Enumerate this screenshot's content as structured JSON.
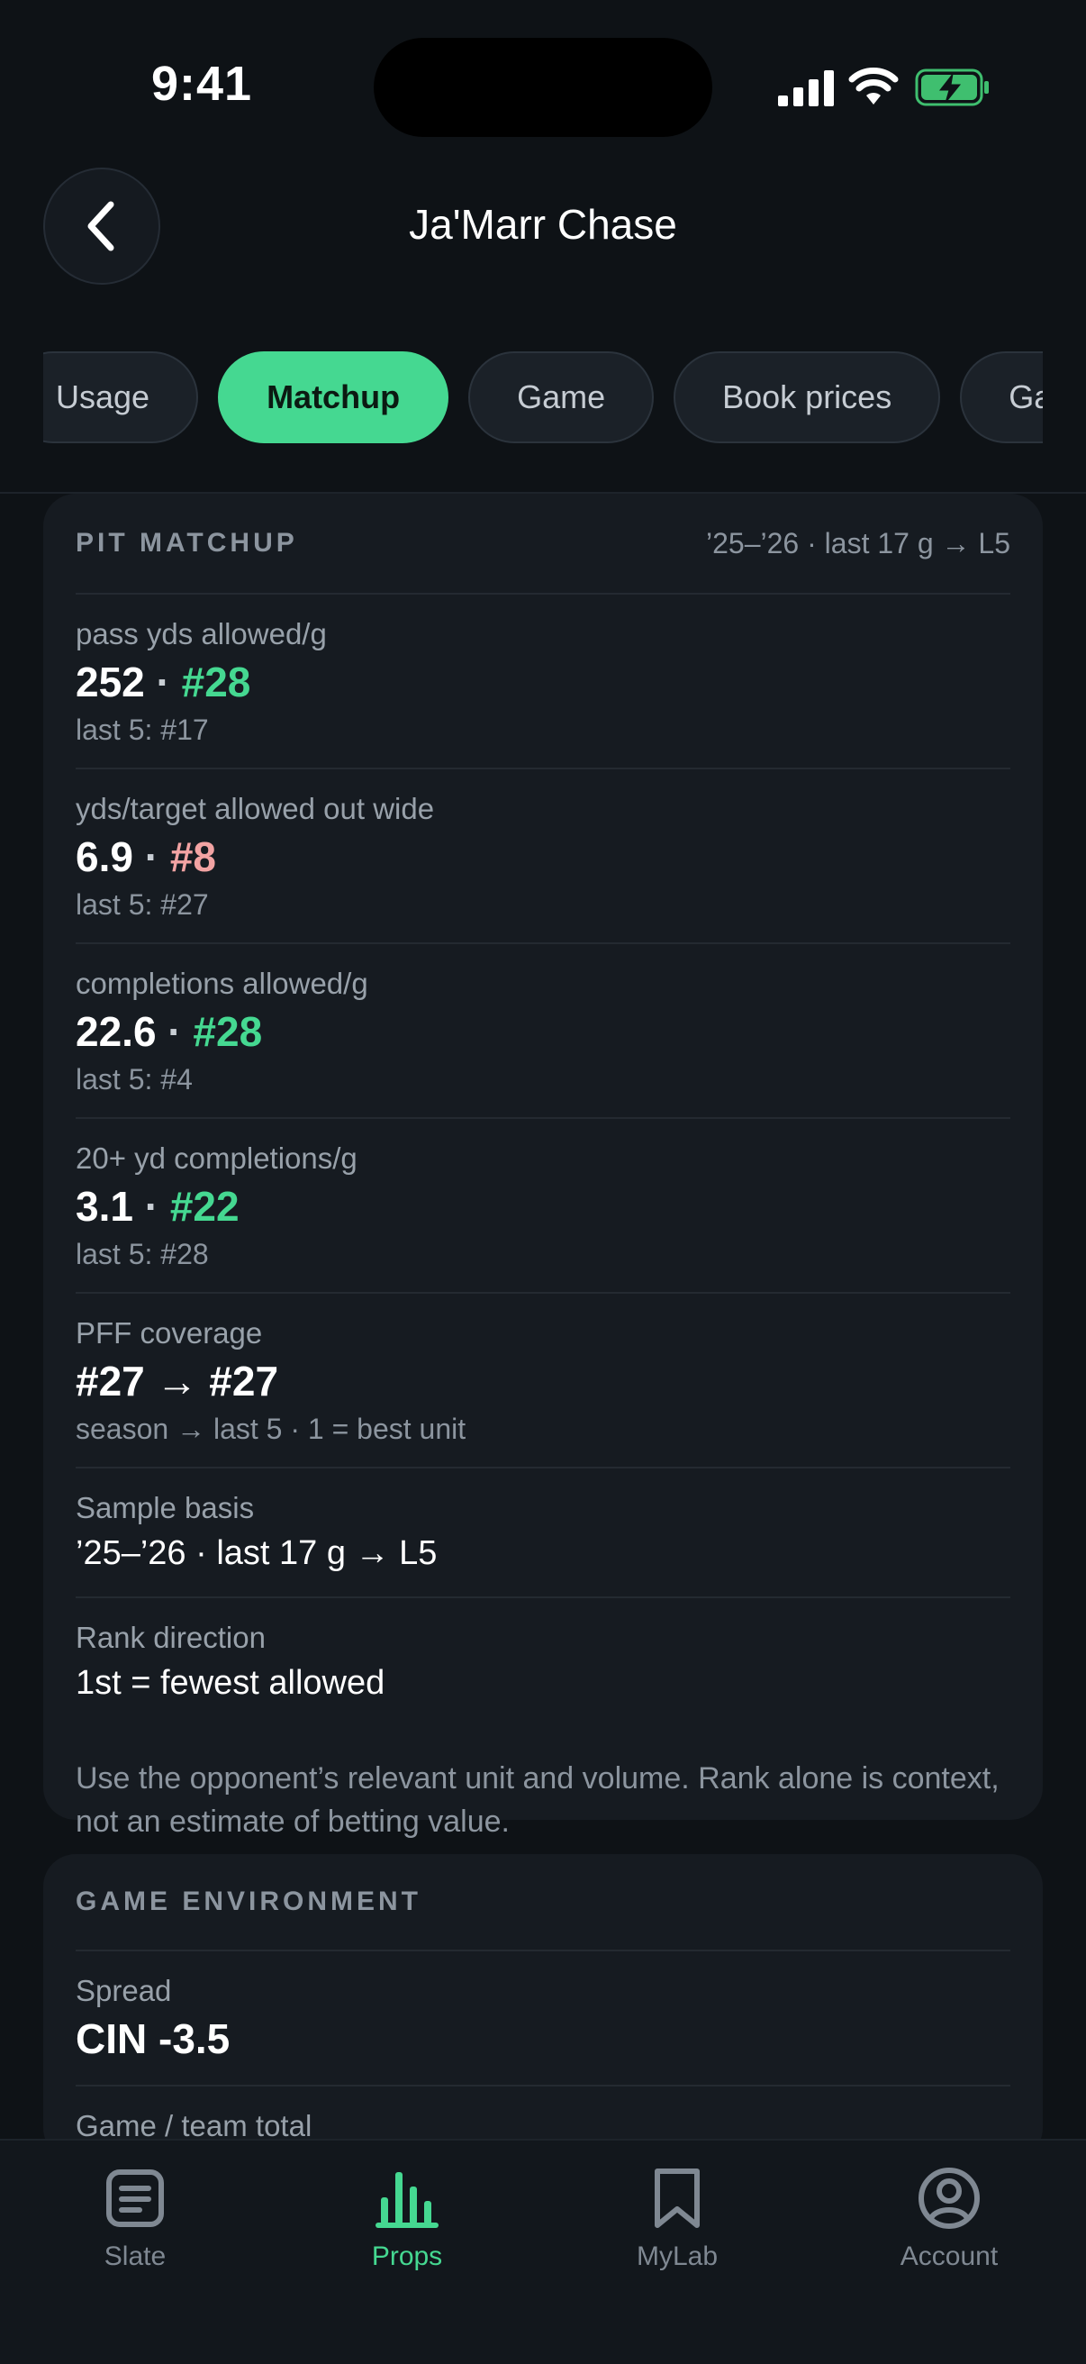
{
  "status": {
    "time": "9:41"
  },
  "header": {
    "title": "Ja'Marr Chase"
  },
  "tabs": [
    {
      "label": "Usage",
      "active": false
    },
    {
      "label": "Matchup",
      "active": true
    },
    {
      "label": "Game",
      "active": false
    },
    {
      "label": "Book prices",
      "active": false
    },
    {
      "label": "Game",
      "active": false
    }
  ],
  "matchup": {
    "title": "PIT MATCHUP",
    "meta": "’25–’26 · last 17 g → L5",
    "rows": [
      {
        "label": "pass yds allowed/g",
        "value": "252",
        "rank": "#28",
        "sub": "last 5: #17"
      },
      {
        "label": "yds/target allowed out wide",
        "value": "6.9",
        "rank": "#8",
        "sub": "last 5: #27"
      },
      {
        "label": "completions allowed/g",
        "value": "22.6",
        "rank": "#28",
        "sub": "last 5: #4"
      },
      {
        "label": "20+ yd completions/g",
        "value": "3.1",
        "rank": "#22",
        "sub": "last 5: #28"
      },
      {
        "label": "PFF coverage",
        "value": "#27 → #27",
        "sub": "season → last 5 · 1 = best unit"
      },
      {
        "label": "Sample basis",
        "value": "’25–’26 · last 17 g → L5"
      },
      {
        "label": "Rank direction",
        "value": "1st = fewest allowed"
      }
    ],
    "note": "Use the opponent’s relevant unit and volume. Rank alone is context, not an estimate of betting value."
  },
  "environment": {
    "title": "GAME ENVIRONMENT",
    "rows": [
      {
        "label": "Spread",
        "value": "CIN -3.5"
      },
      {
        "label": "Game / team total"
      }
    ]
  },
  "nav": [
    {
      "label": "Slate",
      "icon": "document-icon",
      "active": false
    },
    {
      "label": "Props",
      "icon": "bar-chart-icon",
      "active": true
    },
    {
      "label": "MyLab",
      "icon": "bookmark-icon",
      "active": false
    },
    {
      "label": "Account",
      "icon": "user-circle-icon",
      "active": false
    }
  ],
  "colors": {
    "accent": "#45d891",
    "negative": "#f2a3a3",
    "background": "#0e1216",
    "card": "#161b21"
  }
}
